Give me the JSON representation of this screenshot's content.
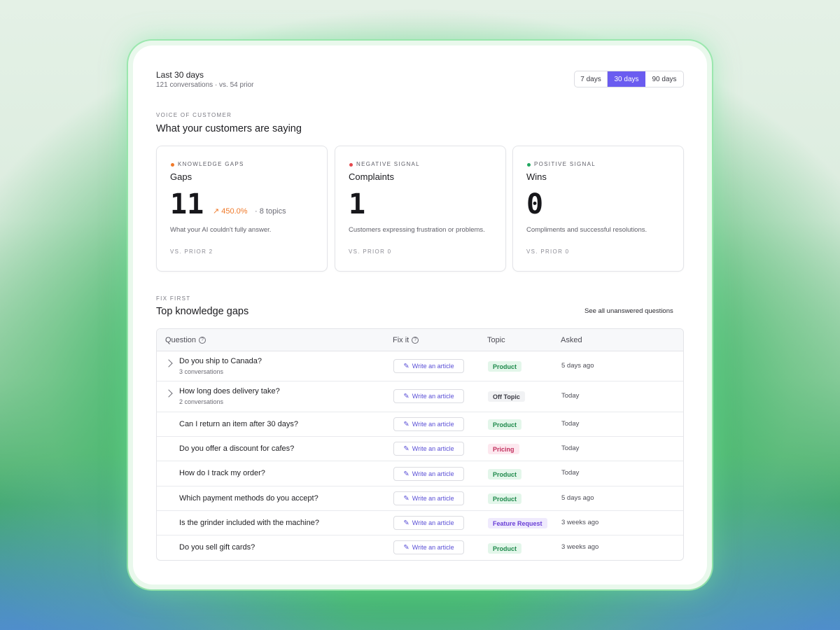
{
  "header": {
    "title": "Last 30 days",
    "subtitle": "121 conversations · vs. 54 prior",
    "ranges": [
      "7 days",
      "30 days",
      "90 days"
    ],
    "active_range": "30 days"
  },
  "voice": {
    "eyebrow": "VOICE OF CUSTOMER",
    "title": "What your customers are saying"
  },
  "cards": [
    {
      "eyebrow": "KNOWLEDGE GAPS",
      "title": "Gaps",
      "value": "11",
      "change": "↗ 450.0%",
      "topics": "· 8 topics",
      "description": "What your AI couldn't fully answer.",
      "prior": "VS. PRIOR 2",
      "dot_color": "#f07a2a"
    },
    {
      "eyebrow": "NEGATIVE SIGNAL",
      "title": "Complaints",
      "value": "1",
      "description": "Customers expressing frustration or problems.",
      "prior": "VS. PRIOR 0",
      "dot_color": "#e5484d"
    },
    {
      "eyebrow": "POSITIVE SIGNAL",
      "title": "Wins",
      "value": "0",
      "description": "Compliments and successful resolutions.",
      "prior": "VS. PRIOR 0",
      "dot_color": "#22a861"
    }
  ],
  "gaps": {
    "eyebrow": "FIX FIRST",
    "title": "Top knowledge gaps",
    "see_all": "See all unanswered questions",
    "columns": [
      "Question",
      "Fix it",
      "Topic",
      "Asked"
    ],
    "fix_label": "Write an article",
    "rows": [
      {
        "question": "Do you ship to Canada?",
        "sub": "3 conversations",
        "topic": "Product",
        "asked": "5 days ago"
      },
      {
        "question": "How long does delivery take?",
        "sub": "2 conversations",
        "topic": "Off Topic",
        "asked": "Today"
      },
      {
        "question": "Can I return an item after 30 days?",
        "topic": "Product",
        "asked": "Today"
      },
      {
        "question": "Do you offer a discount for cafes?",
        "topic": "Pricing",
        "asked": "Today"
      },
      {
        "question": "How do I track my order?",
        "topic": "Product",
        "asked": "Today"
      },
      {
        "question": "Which payment methods do you accept?",
        "topic": "Product",
        "asked": "5 days ago"
      },
      {
        "question": "Is the grinder included with the machine?",
        "topic": "Feature Request",
        "asked": "3 weeks ago"
      },
      {
        "question": "Do you sell gift cards?",
        "topic": "Product",
        "asked": "3 weeks ago"
      }
    ]
  },
  "topic_colors": {
    "Product": {
      "bg": "#e3f6ea",
      "fg": "#1f8a4c"
    },
    "Off Topic": {
      "bg": "#f1f2f4",
      "fg": "#3b3b44"
    },
    "Pricing": {
      "bg": "#fde8ef",
      "fg": "#c2315f"
    },
    "Feature Request": {
      "bg": "#efeafd",
      "fg": "#6a3fd6"
    }
  },
  "accent": "#6a5cf0"
}
